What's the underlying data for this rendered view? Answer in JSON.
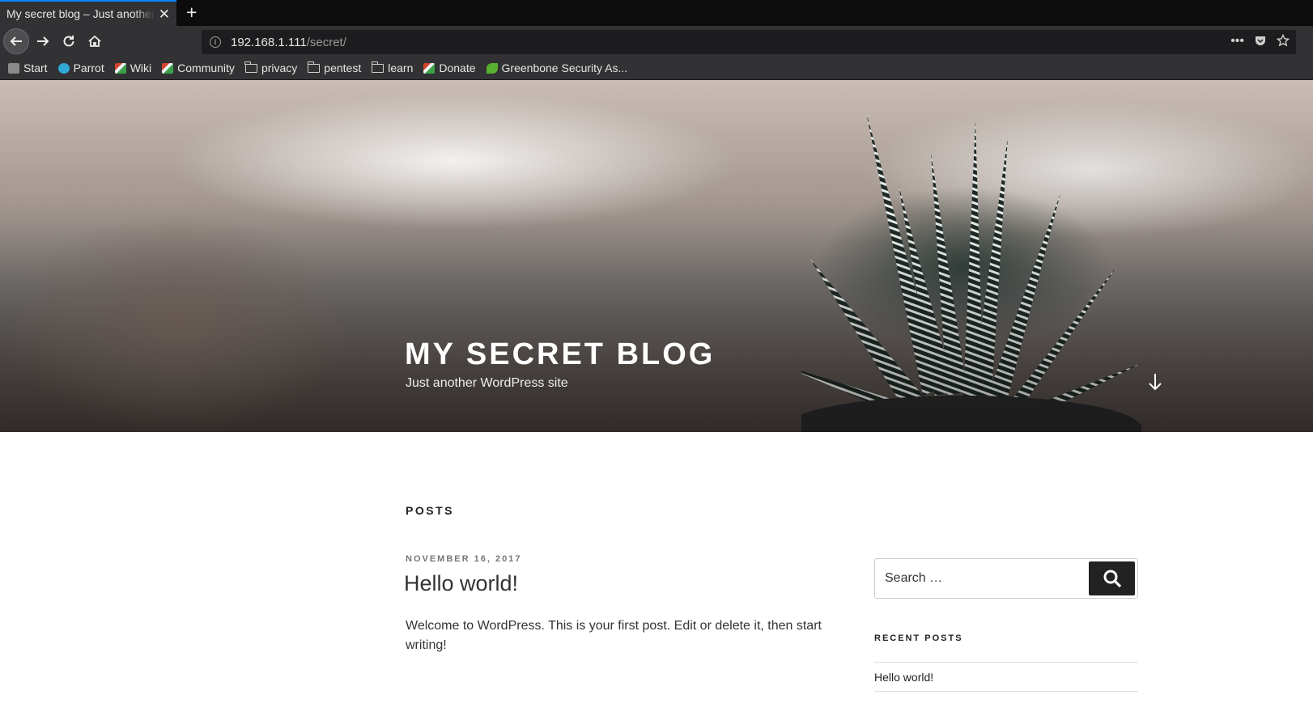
{
  "browser": {
    "tab_title": "My secret blog – Just another WordPress site",
    "url_host": "192.168.1.111",
    "url_path": "/secret/",
    "bookmarks": [
      {
        "label": "Start",
        "icon": "start-icon"
      },
      {
        "label": "Parrot",
        "icon": "parrot-icon"
      },
      {
        "label": "Wiki",
        "icon": "wiki-icon"
      },
      {
        "label": "Community",
        "icon": "community-icon"
      },
      {
        "label": "privacy",
        "icon": "folder-icon"
      },
      {
        "label": "pentest",
        "icon": "folder-icon"
      },
      {
        "label": "learn",
        "icon": "folder-icon"
      },
      {
        "label": "Donate",
        "icon": "donate-icon"
      },
      {
        "label": "Greenbone Security As...",
        "icon": "greenbone-icon"
      }
    ]
  },
  "site": {
    "title": "MY SECRET BLOG",
    "description": "Just another WordPress site"
  },
  "main": {
    "section_heading": "POSTS",
    "post": {
      "date": "NOVEMBER 16, 2017",
      "title": "Hello world!",
      "body": "Welcome to WordPress. This is your first post. Edit or delete it, then start writing!"
    }
  },
  "sidebar": {
    "search_placeholder": "Search …",
    "recent_heading": "RECENT POSTS",
    "recent_posts": [
      "Hello world!"
    ]
  },
  "colors": {
    "accent_tab": "#0a84ff",
    "chrome_bg": "#323234",
    "search_button": "#222222"
  }
}
